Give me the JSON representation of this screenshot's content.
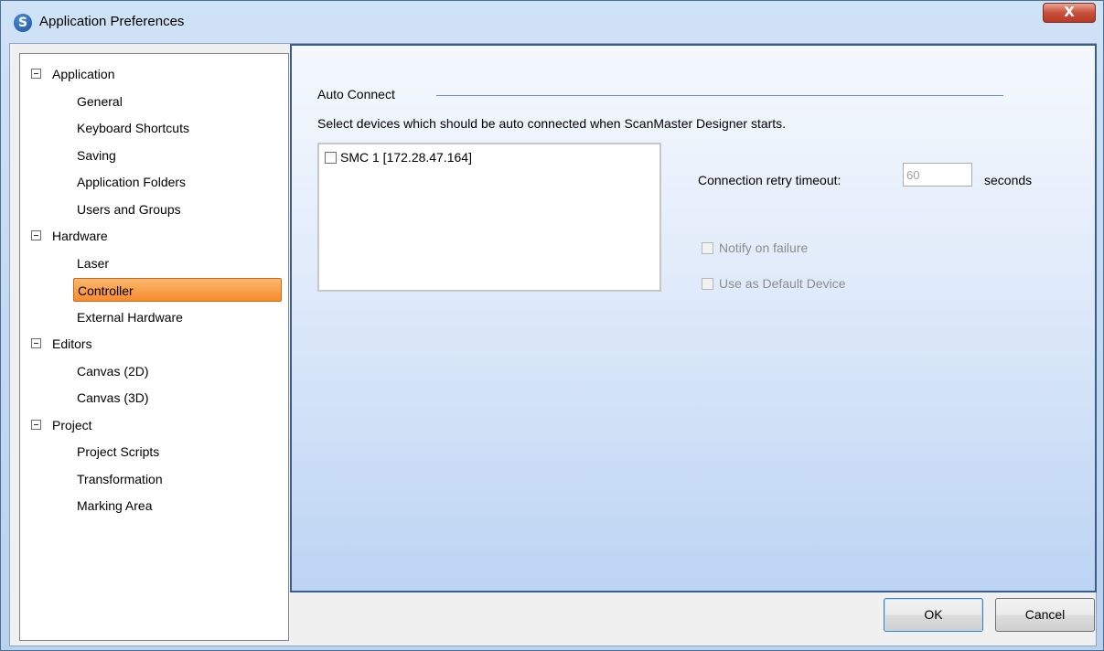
{
  "window": {
    "title": "Application Preferences",
    "close_glyph": "X",
    "logo_glyph": "S"
  },
  "tree": {
    "groups": [
      {
        "label": "Application",
        "items": [
          "General",
          "Keyboard Shortcuts",
          "Saving",
          "Application Folders",
          "Users and Groups"
        ]
      },
      {
        "label": "Hardware",
        "items": [
          "Laser",
          "Controller",
          "External Hardware"
        ]
      },
      {
        "label": "Editors",
        "items": [
          "Canvas (2D)",
          "Canvas (3D)"
        ]
      },
      {
        "label": "Project",
        "items": [
          "Project Scripts",
          "Transformation",
          "Marking Area"
        ]
      }
    ],
    "selected": "Controller"
  },
  "panel": {
    "section_title": "Auto Connect",
    "description": "Select devices which should be auto connected when ScanMaster Designer starts.",
    "devices": [
      {
        "label": "SMC 1 [172.28.47.164]",
        "checked": false
      }
    ],
    "retry_label": "Connection retry timeout:",
    "retry_value": "60",
    "retry_unit": "seconds",
    "notify_label": "Notify on failure",
    "default_device_label": "Use as Default Device"
  },
  "buttons": {
    "ok": "OK",
    "cancel": "Cancel"
  },
  "colors": {
    "selection": "#f78b2d",
    "content_border": "#3b5d86",
    "close": "#c9503b"
  }
}
